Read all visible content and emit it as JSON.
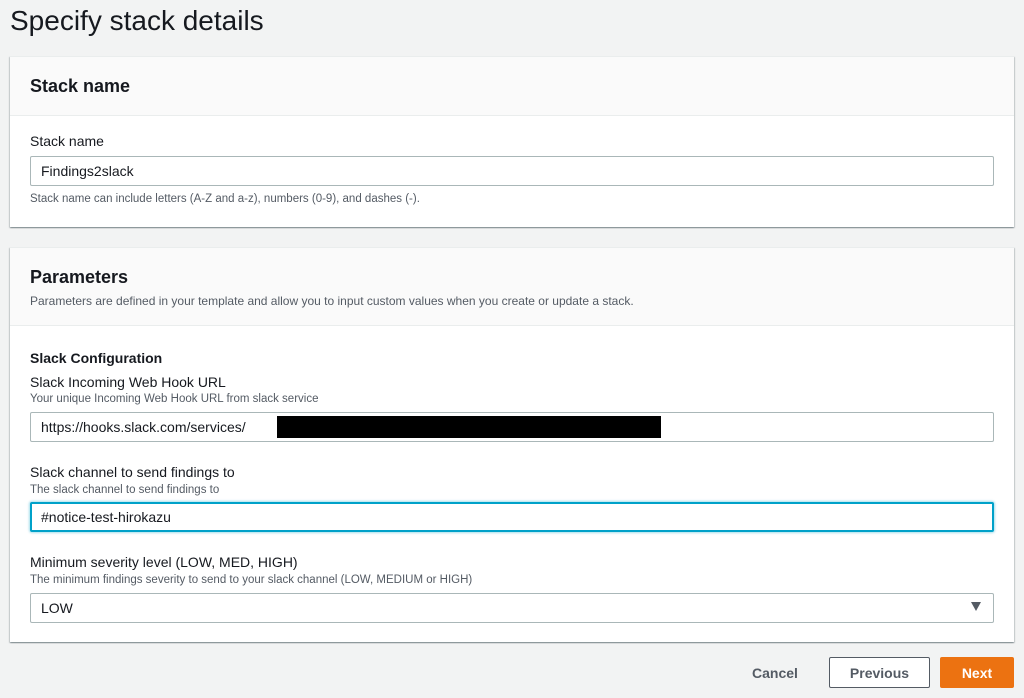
{
  "page": {
    "title": "Specify stack details"
  },
  "stack_name_panel": {
    "title": "Stack name",
    "field_label": "Stack name",
    "field_value": "Findings2slack",
    "field_hint": "Stack name can include letters (A-Z and a-z), numbers (0-9), and dashes (-)."
  },
  "parameters_panel": {
    "title": "Parameters",
    "description": "Parameters are defined in your template and allow you to input custom values when you create or update a stack.",
    "section_title": "Slack Configuration",
    "webhook": {
      "label": "Slack Incoming Web Hook URL",
      "hint": "Your unique Incoming Web Hook URL from slack service",
      "value": "https://hooks.slack.com/services/"
    },
    "channel": {
      "label": "Slack channel to send findings to",
      "hint": "The slack channel to send findings to",
      "value": "#notice-test-hirokazu"
    },
    "severity": {
      "label": "Minimum severity level (LOW, MED, HIGH)",
      "hint": "The minimum findings severity to send to your slack channel (LOW, MEDIUM or HIGH)",
      "selected": "LOW"
    }
  },
  "footer": {
    "cancel_label": "Cancel",
    "previous_label": "Previous",
    "next_label": "Next"
  },
  "colors": {
    "accent": "#ec7211",
    "focus": "#00a1c9",
    "background": "#f2f3f3"
  },
  "icons": {
    "select": "caret-down-icon"
  }
}
